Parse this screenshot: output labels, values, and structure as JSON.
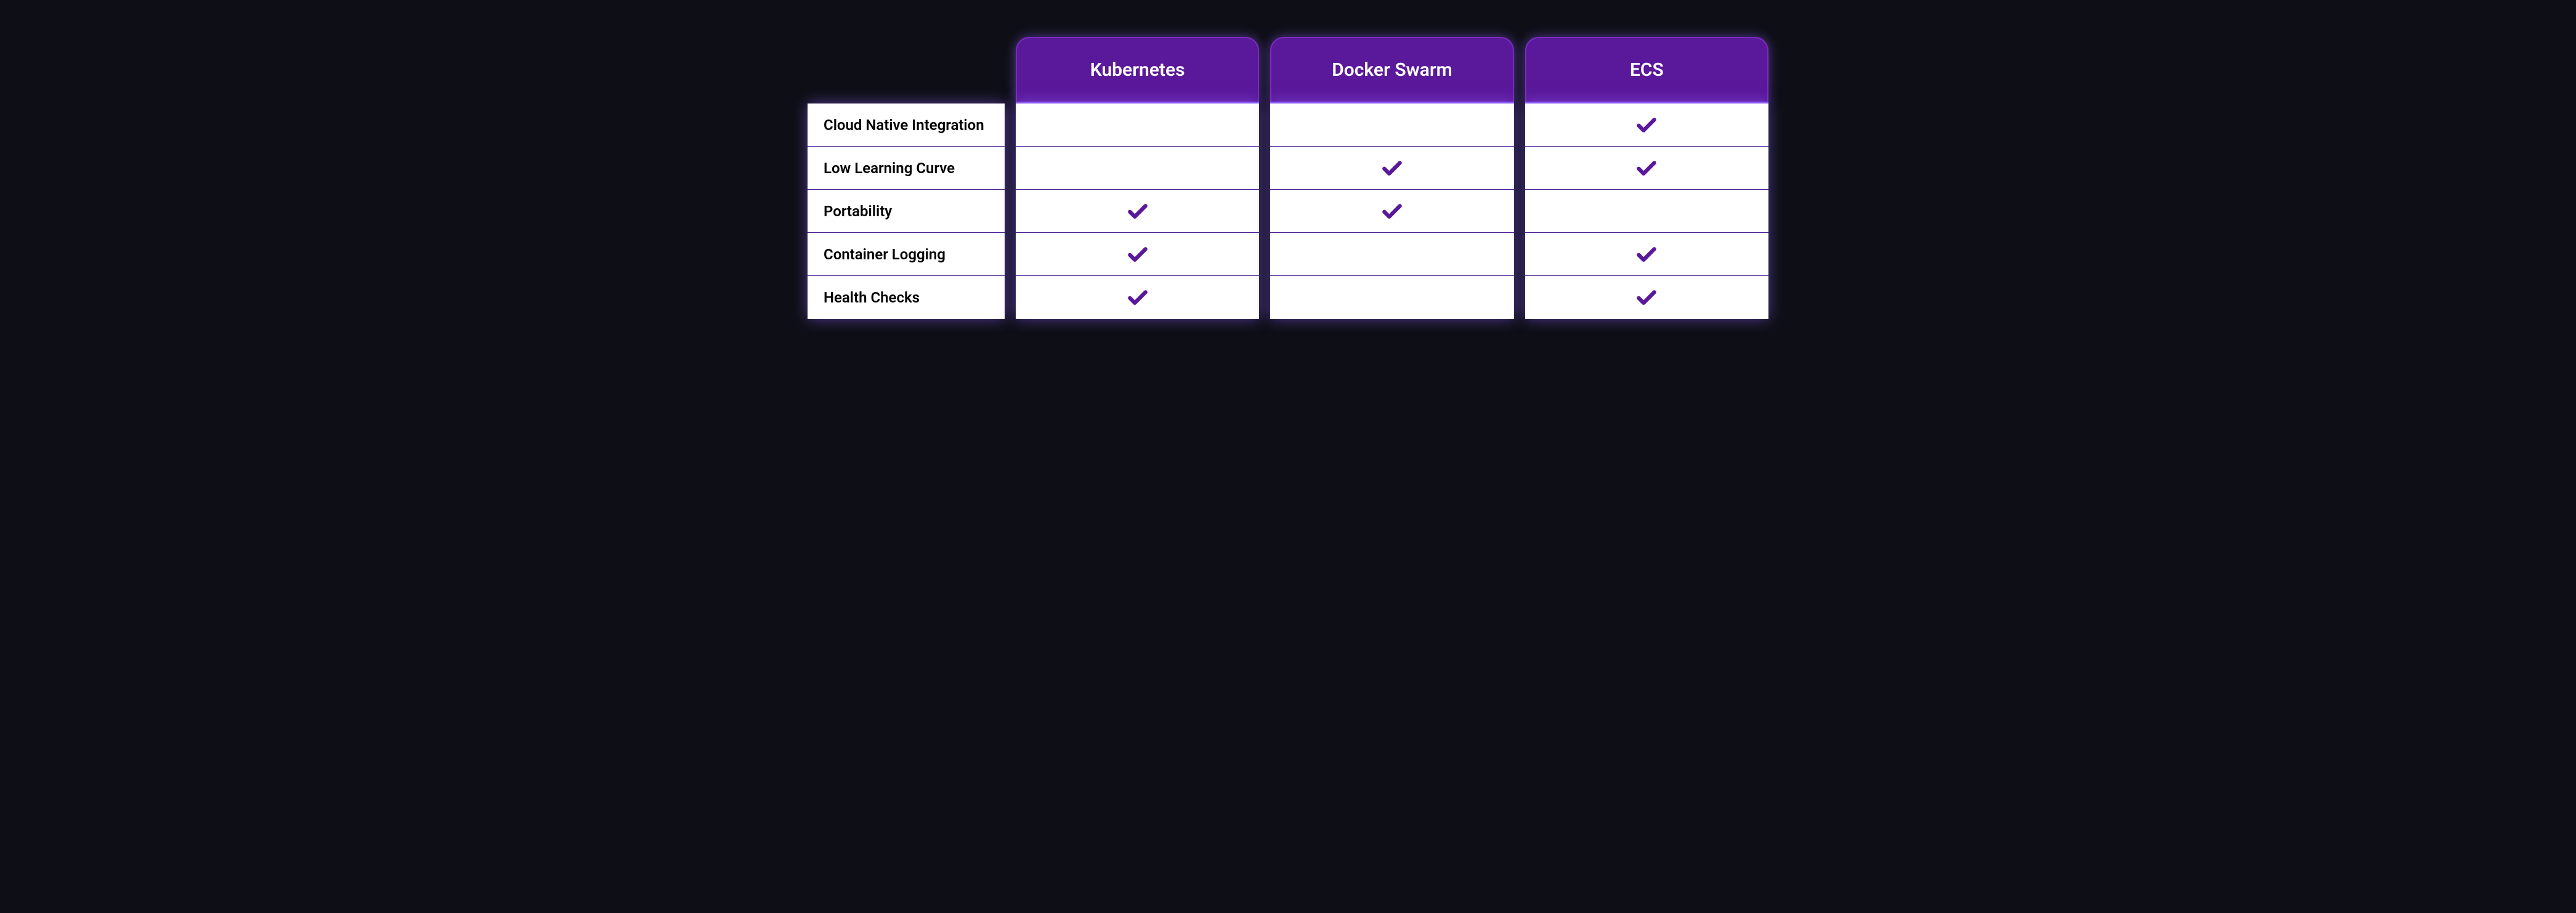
{
  "chart_data": {
    "type": "table",
    "title": "",
    "columns": [
      "Kubernetes",
      "Docker Swarm",
      "ECS"
    ],
    "rows": [
      "Cloud Native Integration",
      "Low Learning Curve",
      "Portability",
      "Container Logging",
      "Health Checks"
    ],
    "matrix": [
      [
        false,
        false,
        true
      ],
      [
        false,
        true,
        true
      ],
      [
        true,
        true,
        false
      ],
      [
        true,
        false,
        true
      ],
      [
        true,
        false,
        true
      ]
    ]
  },
  "colors": {
    "header_bg": "#5a189a",
    "accent": "#8b5cf6",
    "cell_bg": "#ffffff",
    "page_bg": "#0e0f16"
  }
}
